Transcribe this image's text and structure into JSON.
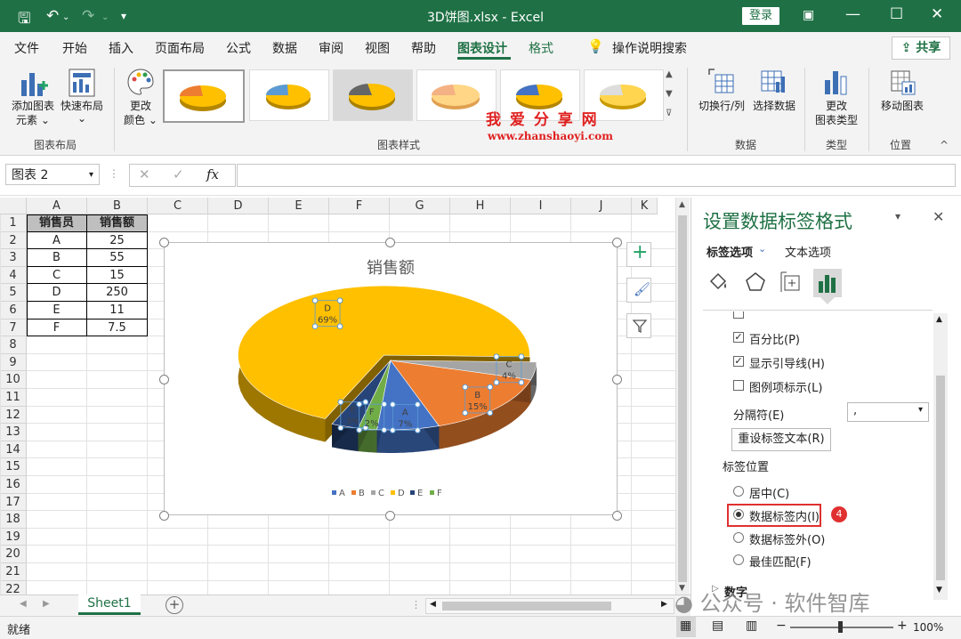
{
  "titlebar": {
    "filename": "3D饼图.xlsx",
    "separator": "-",
    "app": "Excel",
    "login": "登录"
  },
  "menu": {
    "items": [
      "文件",
      "开始",
      "插入",
      "页面布局",
      "公式",
      "数据",
      "审阅",
      "视图",
      "帮助",
      "图表设计",
      "格式"
    ],
    "active": "图表设计",
    "search": "操作说明搜索",
    "share": "共享"
  },
  "ribbon": {
    "add_element": [
      "添加图表",
      "元素"
    ],
    "quick_layout": "快速布局",
    "change_color": [
      "更改",
      "颜色"
    ],
    "group_layout": "图表布局",
    "group_styles": "图表样式",
    "switch_rowcol": "切换行/列",
    "select_data": "选择数据",
    "group_data": "数据",
    "change_type": [
      "更改",
      "图表类型"
    ],
    "group_type": "类型",
    "move_chart": "移动图表",
    "group_location": "位置",
    "watermark_cn": "我 爱 分 享 网",
    "watermark_url": "www.zhanshaoyi.com"
  },
  "formula": {
    "namebox": "图表 2",
    "fx": "fx"
  },
  "grid": {
    "columns": [
      "A",
      "B",
      "C",
      "D",
      "E",
      "F",
      "G",
      "H",
      "I",
      "J",
      "K"
    ],
    "rows": [
      "1",
      "2",
      "3",
      "4",
      "5",
      "6",
      "7",
      "8",
      "9",
      "10",
      "11",
      "12",
      "13",
      "14",
      "15",
      "16",
      "17",
      "18",
      "19",
      "20",
      "21",
      "22"
    ],
    "table": {
      "headers": [
        "销售员",
        "销售额"
      ],
      "data": [
        [
          "A",
          "25"
        ],
        [
          "B",
          "55"
        ],
        [
          "C",
          "15"
        ],
        [
          "D",
          "250"
        ],
        [
          "E",
          "11"
        ],
        [
          "F",
          "7.5"
        ]
      ]
    }
  },
  "chart_data": {
    "type": "pie",
    "title": "销售额",
    "categories": [
      "A",
      "B",
      "C",
      "D",
      "E",
      "F"
    ],
    "values": [
      25,
      55,
      15,
      250,
      11,
      7.5
    ],
    "data_labels": [
      [
        "A",
        "7%"
      ],
      [
        "B",
        "15%"
      ],
      [
        "C",
        "4%"
      ],
      [
        "D",
        "69%"
      ],
      [
        "E",
        "3%"
      ],
      [
        "F",
        "2%"
      ]
    ],
    "colors": [
      "#4472c4",
      "#ed7d31",
      "#a5a5a5",
      "#ffc000",
      "#264478",
      "#70ad47"
    ],
    "legend": "bottom",
    "style": "3d"
  },
  "pane": {
    "title": "设置数据标签格式",
    "tab_label_options": "标签选项",
    "tab_text_options": "文本选项",
    "percent": "百分比(P)",
    "leader_lines": "显示引导线(H)",
    "legend_key": "图例项标示(L)",
    "separator_label": "分隔符(E)",
    "separator_value": ",",
    "reset_button": "重设标签文本(R)",
    "position_heading": "标签位置",
    "pos_center": "居中(C)",
    "pos_inside_end": "数据标签内(I)",
    "pos_outside_end": "数据标签外(O)",
    "pos_best_fit": "最佳匹配(F)",
    "number_section": "数字",
    "step_badge": "4"
  },
  "sheets": {
    "active": "Sheet1"
  },
  "status": {
    "ready": "就绪",
    "zoom": "100%",
    "watermark": "公众号 · 软件智库"
  }
}
